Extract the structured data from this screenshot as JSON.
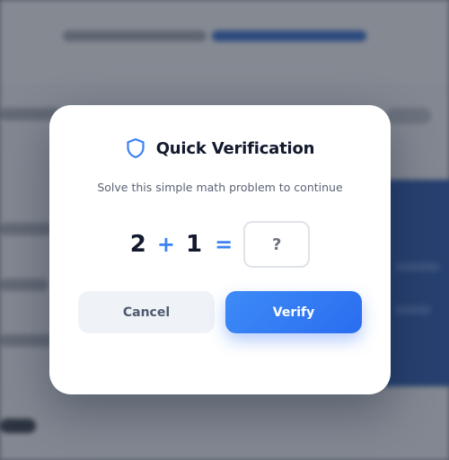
{
  "dialog": {
    "icon": "shield-icon",
    "title": "Quick Verification",
    "subtitle": "Solve this simple math problem to continue",
    "equation": {
      "operand_a": "2",
      "operator": "+",
      "operand_b": "1",
      "equals": "=",
      "answer_placeholder": "?",
      "answer_value": ""
    },
    "buttons": {
      "cancel_label": "Cancel",
      "verify_label": "Verify"
    }
  },
  "colors": {
    "accent": "#3c82f0",
    "title_text": "#141a2e",
    "subtitle_text": "#5a6375",
    "cancel_bg": "#eff2f7",
    "verify_bg": "#2f74f2",
    "modal_bg": "#ffffff"
  }
}
